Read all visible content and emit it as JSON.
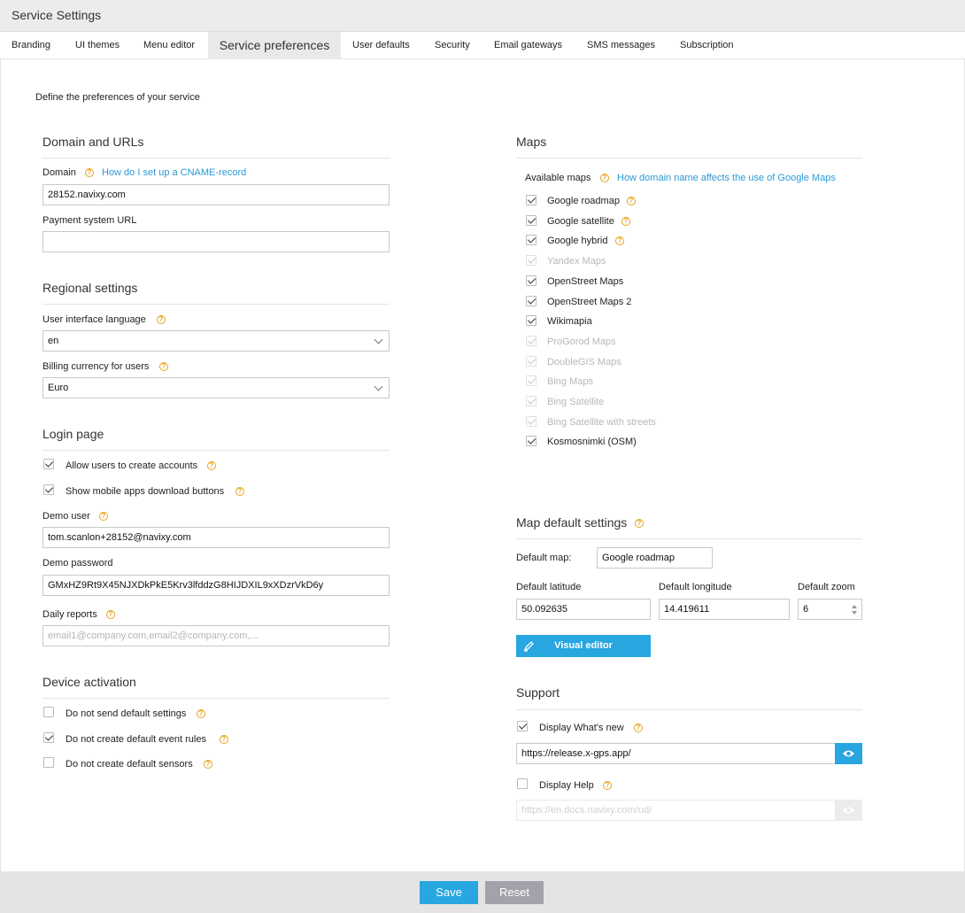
{
  "window": {
    "title": "Service Settings"
  },
  "tabs": [
    {
      "label": "Branding"
    },
    {
      "label": "UI themes"
    },
    {
      "label": "Menu editor"
    },
    {
      "label": "Service preferences"
    },
    {
      "label": "User defaults"
    },
    {
      "label": "Security"
    },
    {
      "label": "Email gateways"
    },
    {
      "label": "SMS messages"
    },
    {
      "label": "Subscription"
    }
  ],
  "intro": "Define the preferences of your service",
  "domain": {
    "title": "Domain and URLs",
    "domain_label": "Domain",
    "domain_help_link": "How do I set up a CNAME-record",
    "domain_value": "28152.navixy.com",
    "payment_label": "Payment system URL",
    "payment_value": ""
  },
  "regional": {
    "title": "Regional settings",
    "language_label": "User interface language",
    "language_value": "en",
    "currency_label": "Billing currency for users",
    "currency_value": "Euro"
  },
  "login": {
    "title": "Login page",
    "allow_accounts_label": "Allow users to create accounts",
    "allow_accounts_checked": true,
    "mobile_apps_label": "Show mobile apps download buttons",
    "mobile_apps_checked": true,
    "demo_user_label": "Demo user",
    "demo_user_value": "tom.scanlon+28152@navixy.com",
    "demo_password_label": "Demo password",
    "demo_password_value": "GMxHZ9Rt9X45NJXDkPkE5Krv3lfddzG8HIJDXIL9xXDzrVkD6y",
    "daily_reports_label": "Daily reports",
    "daily_reports_placeholder": "email1@company.com,email2@company.com,..."
  },
  "device": {
    "title": "Device activation",
    "items": [
      {
        "label": "Do not send default settings",
        "checked": false
      },
      {
        "label": "Do not create default event rules",
        "checked": true
      },
      {
        "label": "Do not create default sensors",
        "checked": false
      }
    ]
  },
  "maps": {
    "title": "Maps",
    "available_label": "Available maps",
    "help_link": "How domain name affects the use of Google Maps",
    "items": [
      {
        "label": "Google roadmap",
        "checked": true,
        "disabled": false,
        "help": true
      },
      {
        "label": "Google satellite",
        "checked": true,
        "disabled": false,
        "help": true
      },
      {
        "label": "Google hybrid",
        "checked": true,
        "disabled": false,
        "help": true
      },
      {
        "label": "Yandex Maps",
        "checked": true,
        "disabled": true,
        "help": false
      },
      {
        "label": "OpenStreet Maps",
        "checked": true,
        "disabled": false,
        "help": false
      },
      {
        "label": "OpenStreet Maps 2",
        "checked": true,
        "disabled": false,
        "help": false
      },
      {
        "label": "Wikimapia",
        "checked": true,
        "disabled": false,
        "help": false
      },
      {
        "label": "ProGorod Maps",
        "checked": true,
        "disabled": true,
        "help": false
      },
      {
        "label": "DoubleGIS Maps",
        "checked": true,
        "disabled": true,
        "help": false
      },
      {
        "label": "Bing Maps",
        "checked": true,
        "disabled": true,
        "help": false
      },
      {
        "label": "Bing Satellite",
        "checked": true,
        "disabled": true,
        "help": false
      },
      {
        "label": "Bing Satellite with streets",
        "checked": true,
        "disabled": true,
        "help": false
      },
      {
        "label": "Kosmosnimki (OSM)",
        "checked": true,
        "disabled": false,
        "help": false
      }
    ]
  },
  "map_defaults": {
    "title": "Map default settings",
    "default_map_label": "Default map:",
    "default_map_value": "Google roadmap",
    "latitude_label": "Default latitude",
    "latitude_value": "50.092635",
    "longitude_label": "Default longitude",
    "longitude_value": "14.419611",
    "zoom_label": "Default zoom",
    "zoom_value": "6",
    "visual_editor_label": "Visual editor"
  },
  "support": {
    "title": "Support",
    "whats_new_label": "Display What's new",
    "whats_new_checked": true,
    "whats_new_url": "https://release.x-gps.app/",
    "help_label": "Display Help",
    "help_checked": false,
    "help_url": "https://en.docs.navixy.com/ud/"
  },
  "footer": {
    "save_label": "Save",
    "reset_label": "Reset"
  },
  "colors": {
    "accent": "#27a6e0",
    "help_icon": "#e8a31e",
    "reset": "#a2a2aa"
  },
  "icons": {
    "help": "question-circle-icon",
    "edit": "pencil-icon",
    "view": "eye-icon"
  }
}
